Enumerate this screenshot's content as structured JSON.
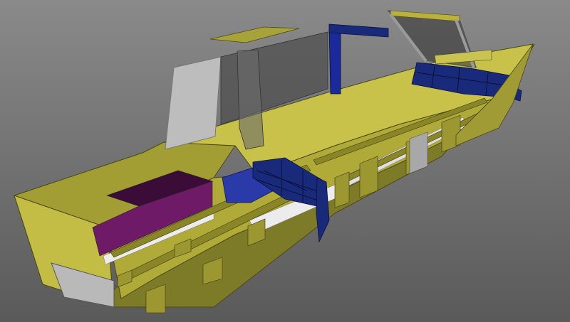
{
  "viewport": {
    "background_top": "#8a8a8a",
    "background_bottom": "#5a5a5a"
  },
  "model": {
    "hull_color": "#b9b13c",
    "hull_dark": "#8f8a2c",
    "hull_light": "#c9c451",
    "hull_outline": "#4a4818",
    "frame_color": "#1a2a7a",
    "frame_dark": "#0e1652",
    "tank_color": "#6e1a66",
    "tank_dark": "#3c0c38",
    "glass_color": "#5a5a5a",
    "glass_light": "#c9c9c9",
    "white_strip": "#ececec"
  }
}
